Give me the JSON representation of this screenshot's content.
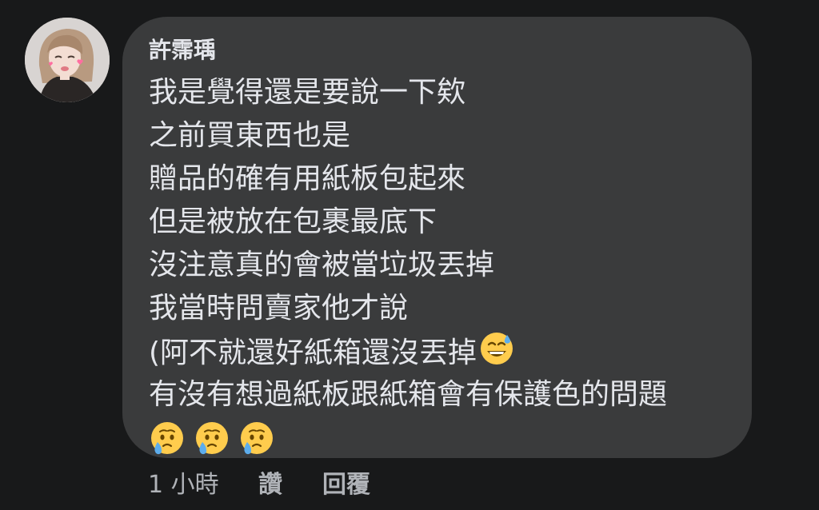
{
  "comment": {
    "author": "許霈瑀",
    "lines": [
      "我是覺得還是要說一下欸",
      "之前買東西也是",
      "贈品的確有用紙板包起來",
      "但是被放在包裹最底下",
      "沒注意真的會被當垃圾丟掉",
      "我當時問賣家他才說",
      "(阿不就還好紙箱還沒丟掉",
      "有沒有想過紙板跟紙箱會有保護色的問題"
    ],
    "emoji_after_line_7": "grinning-face-with-sweat",
    "emoji_row": [
      "face-holding-back-tears",
      "face-holding-back-tears",
      "face-holding-back-tears"
    ]
  },
  "actions": {
    "time": "1 小時",
    "like": "讚",
    "reply": "回覆"
  },
  "colors": {
    "background": "#18191a",
    "bubble": "#3a3b3c",
    "text": "#e4e6eb",
    "meta": "#b0b3b8"
  }
}
